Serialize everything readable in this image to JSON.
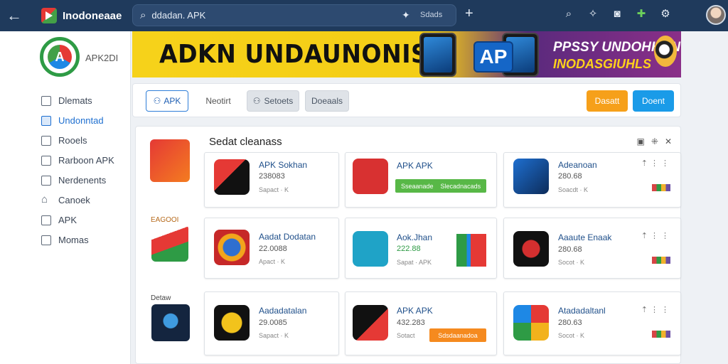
{
  "topbar": {
    "back_icon": "arrow-left-icon",
    "app_title": "Inodoneaae",
    "search_text": "ddadan. APK",
    "search_tag": "Sdads",
    "icons": [
      "search-icon",
      "sparkle-icon",
      "camera-icon",
      "puzzle-icon",
      "settings-icon"
    ]
  },
  "sidebar": {
    "brand_name": "APK2DI",
    "items": [
      {
        "label": "Dlemats",
        "active": false
      },
      {
        "label": "Undonntad",
        "active": true
      },
      {
        "label": "Rooels",
        "active": false
      },
      {
        "label": "Rarboon APK",
        "active": false
      },
      {
        "label": "Nerdenents",
        "active": false
      },
      {
        "label": "Canoek",
        "active": false
      },
      {
        "label": "APK",
        "active": false
      },
      {
        "label": "Momas",
        "active": false
      }
    ]
  },
  "banner": {
    "headline": "ADKN UNDAUNONISIA",
    "badge": "AP",
    "promo_line1": "PPSSY UNDOHHAN",
    "promo_line2": "INODASGIUHLS"
  },
  "toolbar": {
    "apk_button": "APK",
    "plain_button": "Neotirt",
    "gray_button1": "Setoets",
    "gray_button2": "Doeaals",
    "orange_button": "Dasatt",
    "blue_button": "Doent"
  },
  "panel": {
    "title": "Sedat cleanass",
    "side_labels": [
      "EAGOOI",
      "Detaw"
    ],
    "cards": [
      {
        "name": "APK Sokhan",
        "value": "238083",
        "meta": "Sapact · K"
      },
      {
        "name": "APK APK",
        "value": "",
        "meta": "",
        "chip_left": "Sseaanade",
        "chip_right": "Slecadnacads"
      },
      {
        "name": "Adeanoan",
        "value": "280.68",
        "meta": "Soacdt · K"
      },
      {
        "name": "Aadat Dodatan",
        "value": "22.0088",
        "meta": "Apact · K"
      },
      {
        "name": "Aok.Jhan",
        "value": "222.88",
        "meta": "Sapat · APK"
      },
      {
        "name": "Aaaute Enaak",
        "value": "280.68",
        "meta": "Socot · K"
      },
      {
        "name": "Aadadatalan",
        "value": "29.0085",
        "meta": "Sapact · K"
      },
      {
        "name": "APK APK",
        "value": "432.283",
        "meta": "Sotact",
        "chip_orange": "Sdsdaanadoa"
      },
      {
        "name": "Atadadaltanl",
        "value": "280.63",
        "meta": "Socot · K"
      }
    ]
  },
  "colors": {
    "topbar": "#1f3a5c",
    "accent_blue": "#1a9be8",
    "accent_orange": "#f6a01a",
    "banner_yellow": "#f6d21a",
    "green": "#58b847"
  }
}
